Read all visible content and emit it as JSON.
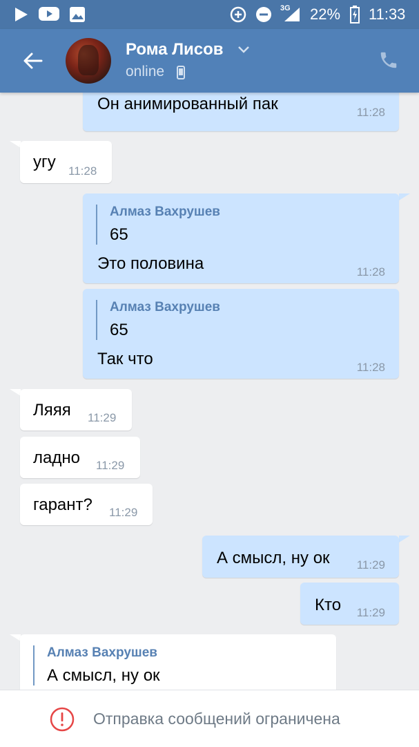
{
  "status_bar": {
    "network": "3G",
    "battery": "22%",
    "time": "11:33",
    "icons": [
      "play-icon",
      "youtube-icon",
      "gallery-icon",
      "data-saver-icon",
      "do-not-disturb-icon",
      "signal-icon",
      "battery-charging-icon"
    ]
  },
  "header": {
    "name": "Рома Лисов",
    "status": "online",
    "icons": [
      "back-arrow-icon",
      "chevron-down-icon",
      "mobile-icon",
      "phone-icon"
    ]
  },
  "messages": [
    {
      "type": "out",
      "text": "Он анимированный пак",
      "time": "11:28"
    },
    {
      "type": "in",
      "text": "угу",
      "time": "11:28"
    },
    {
      "type": "out",
      "reply_name": "Алмаз Вахрушев",
      "reply_text": "65",
      "text": "Это половина",
      "time": "11:28"
    },
    {
      "type": "out",
      "reply_name": "Алмаз Вахрушев",
      "reply_text": "65",
      "text": "Так что",
      "time": "11:28"
    },
    {
      "type": "in",
      "text": "Ляяя",
      "time": "11:29"
    },
    {
      "type": "in",
      "text": "ладно",
      "time": "11:29"
    },
    {
      "type": "in",
      "text": "гарант?",
      "time": "11:29"
    },
    {
      "type": "out",
      "text": "А смысл, ну ок",
      "time": "11:29"
    },
    {
      "type": "out",
      "text": "Кто",
      "time": "11:29"
    },
    {
      "type": "in",
      "reply_name": "Алмаз Вахрушев",
      "reply_text": "А смысл, ну ок"
    }
  ],
  "bottom": {
    "notice": "Отправка сообщений ограничена",
    "icon": "warning-icon"
  },
  "colors": {
    "header": "#5181b8",
    "status_bar": "#4a76a8",
    "outgoing": "#cce4ff",
    "incoming": "#ffffff",
    "background": "#edeef0",
    "warning": "#e64646"
  }
}
